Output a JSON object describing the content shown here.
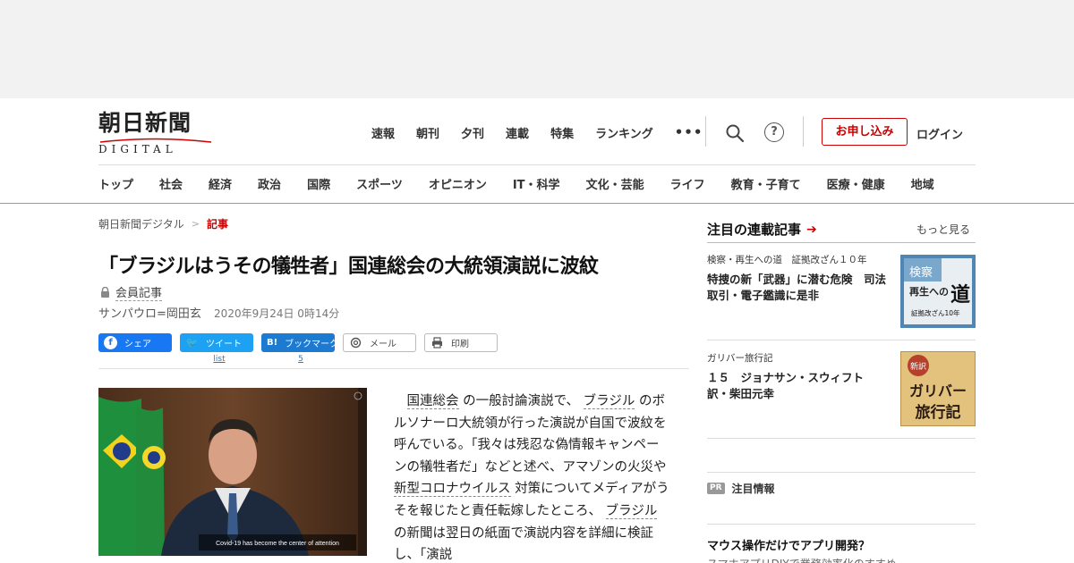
{
  "logo": {
    "main": "朝日新聞",
    "sub": "DIGITAL"
  },
  "topnav": [
    "速報",
    "朝刊",
    "夕刊",
    "連載",
    "特集",
    "ランキング"
  ],
  "header": {
    "more_dots": "•••",
    "help": "?",
    "apply_label": "お申し込み",
    "login_label": "ログイン"
  },
  "catnav": [
    "トップ",
    "社会",
    "経済",
    "政治",
    "国際",
    "スポーツ",
    "オピニオン",
    "IT・科学",
    "文化・芸能",
    "ライフ",
    "教育・子育て",
    "医療・健康",
    "地域"
  ],
  "breadcrumb": {
    "home": "朝日新聞デジタル",
    "sep": ">",
    "current": "記事"
  },
  "article": {
    "title": "「ブラジルはうその犠牲者」国連総会の大統領演説に波紋",
    "member_label": "会員記事",
    "author": "サンパウロ=岡田玄",
    "date": "2020年9月24日 0時14分",
    "photo_caption": "Covid-19 has become the center of attention",
    "body": {
      "link1": "国連総会",
      "t1": "の一般討論演説で、",
      "link2": "ブラジル",
      "t2": "のボルソナーロ大統領が行った演説が自国で波紋を呼んでいる。「我々は残忍な偽情報キャンペーンの犠牲者だ」などと述べ、アマゾンの火災や",
      "link3": "新型コロナウイルス",
      "t3": "対策についてメディアがうそを報じたと責任転嫁したところ、",
      "link4": "ブラジル",
      "t4": "の新聞は翌日の紙面で演説内容を詳細に検証し、「演説"
    }
  },
  "share": {
    "facebook": "シェア",
    "twitter": "ツイート",
    "twitter_sub": "list",
    "hatena": "ブックマーク",
    "hatena_icon": "B!",
    "hatena_count": "5",
    "mail": "メール",
    "print": "印刷"
  },
  "sidebar": {
    "heading": "注目の連載記事",
    "more": "もっと見る",
    "items": [
      {
        "category": "検察・再生への道　証拠改ざん１０年",
        "title": "特捜の新「武器」に潜む危険　司法取引・電子鑑識に是非",
        "thumb_top": "検察",
        "thumb_mid": "再生への",
        "thumb_big": "道",
        "thumb_sub": "証拠改ざん10年"
      },
      {
        "category": "ガリバー旅行記",
        "title": "１５　ジョナサン・スウィフト　訳・柴田元幸",
        "thumb_seal": "新訳",
        "thumb_l1": "ガリバー",
        "thumb_l2": "旅行記"
      }
    ],
    "pr_badge": "PR",
    "pr_label": "注目情報",
    "ad_title": "マウス操作だけでアプリ開発？",
    "ad_sub": "スマホアプリDIYで業務効率化のすすめ"
  },
  "colors": {
    "accent_red": "#cc0000",
    "facebook": "#1877f2",
    "twitter": "#1da1f2",
    "hatena": "#1d7ad1"
  }
}
